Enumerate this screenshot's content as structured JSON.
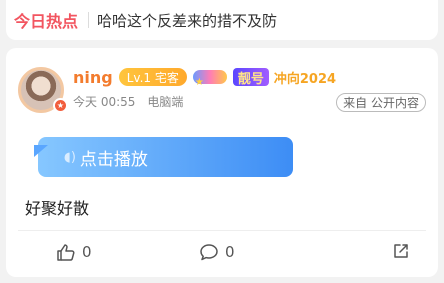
{
  "hot": {
    "title": "今日热点",
    "text": "哈哈这个反差来的措不及防"
  },
  "post": {
    "user": {
      "name": "ning",
      "level": "Lv.1 宅客",
      "vip": "靓号",
      "rush": "冲向2024"
    },
    "time": "今天 00:55",
    "device": "电脑端",
    "source": "来自 公开内容",
    "play_label": "点击播放",
    "text": "好聚好散"
  },
  "actions": {
    "likes": "0",
    "comments": "0"
  },
  "colors": {
    "accent": "#f25560",
    "username": "#f37c2e",
    "play": "#3d8df5"
  },
  "icons": [
    "avatar-badge-icon",
    "sound-wave-icon",
    "thumbs-up-icon",
    "comment-icon",
    "share-icon",
    "medal-icon"
  ]
}
